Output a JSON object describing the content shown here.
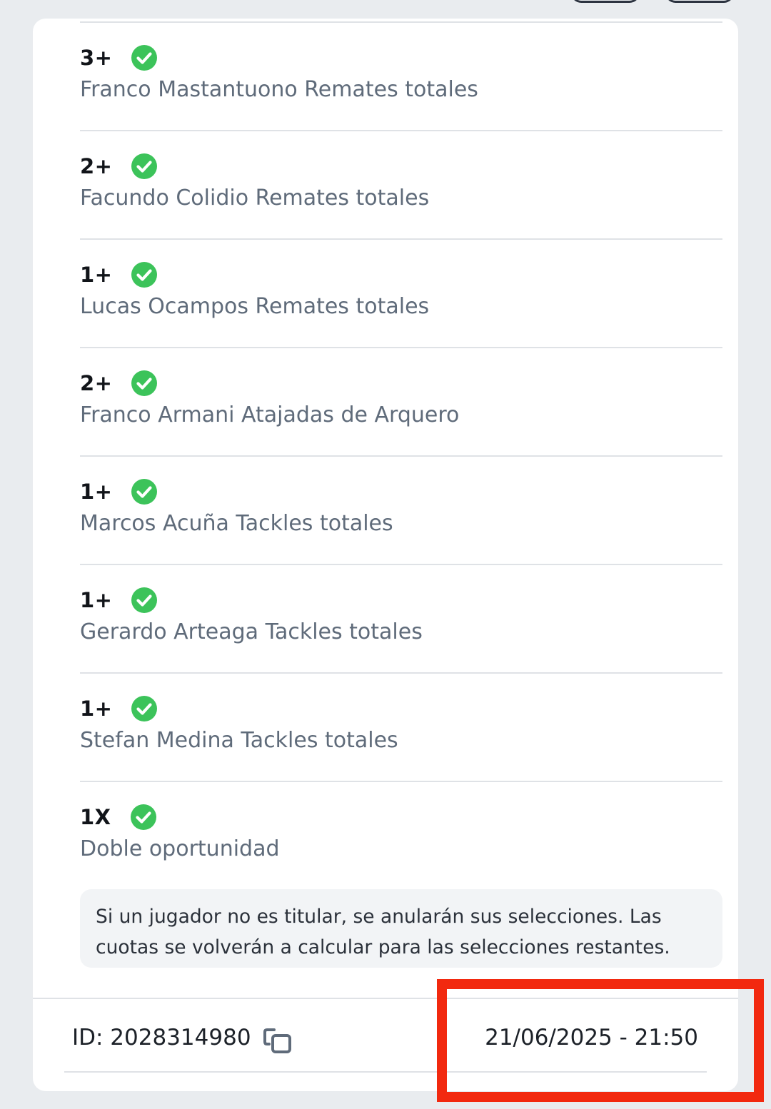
{
  "selections": [
    {
      "line": "3+",
      "market": "Franco Mastantuono Remates totales",
      "status": "won"
    },
    {
      "line": "2+",
      "market": "Facundo Colidio Remates totales",
      "status": "won"
    },
    {
      "line": "1+",
      "market": "Lucas Ocampos Remates totales",
      "status": "won"
    },
    {
      "line": "2+",
      "market": "Franco Armani Atajadas de Arquero",
      "status": "won"
    },
    {
      "line": "1+",
      "market": "Marcos Acuña Tackles totales",
      "status": "won"
    },
    {
      "line": "1+",
      "market": "Gerardo Arteaga Tackles totales",
      "status": "won"
    },
    {
      "line": "1+",
      "market": "Stefan Medina Tackles totales",
      "status": "won"
    },
    {
      "line": "1X",
      "market": "Doble oportunidad",
      "status": "won"
    }
  ],
  "notice": {
    "text": "Si un jugador no es titular, se anularán sus selecciones. Las cuotas se volverán a calcular para las selecciones restantes."
  },
  "footer": {
    "bet_id": "ID: 2028314980",
    "datetime": "21/06/2025 - 21:50",
    "copy_icon": "copy-icon"
  },
  "colors": {
    "success": "#3cc35a",
    "highlight": "#f2290f",
    "text_muted": "#5f6b7a",
    "text_strong": "#111419"
  }
}
